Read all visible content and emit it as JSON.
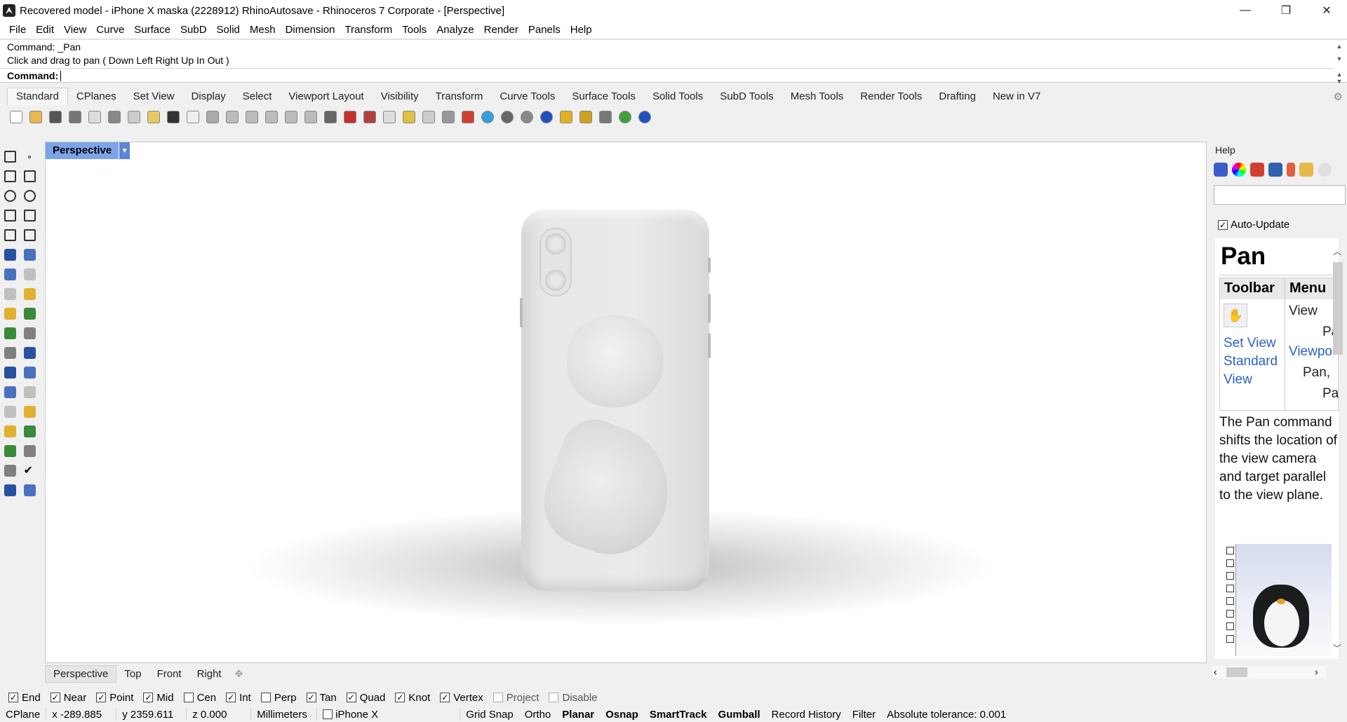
{
  "window": {
    "title": "Recovered model - iPhone X maska (2228912) RhinoAutosave - Rhinoceros 7 Corporate - [Perspective]",
    "minimize": "—",
    "restore": "❐",
    "close": "✕"
  },
  "menu": [
    "File",
    "Edit",
    "View",
    "Curve",
    "Surface",
    "SubD",
    "Solid",
    "Mesh",
    "Dimension",
    "Transform",
    "Tools",
    "Analyze",
    "Render",
    "Panels",
    "Help"
  ],
  "command": {
    "history_1": "Command: _Pan",
    "history_2": "Click and drag to pan ( Down  Left  Right  Up  In  Out )",
    "prompt": "Command:"
  },
  "toolbar_tabs": [
    "Standard",
    "CPlanes",
    "Set View",
    "Display",
    "Select",
    "Viewport Layout",
    "Visibility",
    "Transform",
    "Curve Tools",
    "Surface Tools",
    "Solid Tools",
    "SubD Tools",
    "Mesh Tools",
    "Render Tools",
    "Drafting",
    "New in V7"
  ],
  "toolbar_icons": [
    {
      "name": "new-file-icon",
      "color": "#ffffff"
    },
    {
      "name": "open-folder-icon",
      "color": "#e8b84a"
    },
    {
      "name": "save-icon",
      "color": "#555555"
    },
    {
      "name": "print-icon",
      "color": "#777777"
    },
    {
      "name": "export-icon",
      "color": "#dddddd"
    },
    {
      "name": "cut-icon",
      "color": "#888888"
    },
    {
      "name": "copy-icon",
      "color": "#cccccc"
    },
    {
      "name": "paste-icon",
      "color": "#e8c860"
    },
    {
      "name": "undo-icon",
      "color": "#333333"
    },
    {
      "name": "pan-hand-icon",
      "color": "#eeeeee"
    },
    {
      "name": "rotate-view-icon",
      "color": "#aaaaaa"
    },
    {
      "name": "zoom-icon",
      "color": "#bbbbbb"
    },
    {
      "name": "zoom-window-icon",
      "color": "#bbbbbb"
    },
    {
      "name": "zoom-extents-icon",
      "color": "#bbbbbb"
    },
    {
      "name": "zoom-selected-icon",
      "color": "#bbbbbb"
    },
    {
      "name": "undo-view-icon",
      "color": "#bbbbbb"
    },
    {
      "name": "four-viewports-icon",
      "color": "#666666"
    },
    {
      "name": "car-shaded-icon",
      "color": "#c83030"
    },
    {
      "name": "car-wire-icon",
      "color": "#b04040"
    },
    {
      "name": "gumball-icon",
      "color": "#dddddd"
    },
    {
      "name": "select-points-icon",
      "color": "#e0c040"
    },
    {
      "name": "light-bulb-icon",
      "color": "#cccccc"
    },
    {
      "name": "lock-icon",
      "color": "#999999"
    },
    {
      "name": "layers-icon",
      "color": "#d04030"
    },
    {
      "name": "color-wheel-icon",
      "color": "#30a0e0"
    },
    {
      "name": "sphere-shaded-icon",
      "color": "#666666"
    },
    {
      "name": "sphere-render-icon",
      "color": "#888888"
    },
    {
      "name": "sphere-blue-icon",
      "color": "#2050c0"
    },
    {
      "name": "spotlight-icon",
      "color": "#e0b020"
    },
    {
      "name": "settings-gear-icon",
      "color": "#d0a020"
    },
    {
      "name": "dimension-icon",
      "color": "#777777"
    },
    {
      "name": "globe-icon",
      "color": "#40a040"
    },
    {
      "name": "help-icon",
      "color": "#2050c0"
    }
  ],
  "left_tools": [
    [
      "select-arrow-icon",
      "point-icon"
    ],
    [
      "polyline-icon",
      "curve-control-points-icon"
    ],
    [
      "circle-icon",
      "ellipse-icon"
    ],
    [
      "polygon-icon",
      "rectangle-icon"
    ],
    [
      "fillet-curve-icon",
      "arc-icon"
    ],
    [
      "surface-from-points-icon",
      "extrude-curve-icon"
    ],
    [
      "box-icon",
      "boolean-union-icon"
    ],
    [
      "cylinder-icon",
      "plane-surface-icon"
    ],
    [
      "explode-icon",
      "trim-lightning-icon"
    ],
    [
      "split-icon",
      "join-icon"
    ],
    [
      "group-icon",
      "ungroup-icon"
    ],
    [
      "rotate-icon",
      "offset-icon"
    ],
    [
      "text-icon",
      "scale-icon"
    ],
    [
      "array-icon",
      "mirror-icon"
    ],
    [
      "mesh-box-icon",
      "dimension-line-icon"
    ],
    [
      "grid-array-icon",
      "block-icon"
    ],
    [
      "analyze-icon",
      "check-icon"
    ],
    [
      "render-object-icon",
      "section-icon"
    ]
  ],
  "viewport": {
    "label": "Perspective"
  },
  "view_tabs": [
    "Perspective",
    "Top",
    "Front",
    "Right"
  ],
  "view_tab_add": "✥",
  "panel": {
    "title": "Help",
    "auto_update_label": "Auto-Update",
    "auto_update_checked": true,
    "heading": "Pan",
    "col_toolbar": "Toolbar",
    "col_menu": "Menu",
    "link_set_view": "Set View",
    "link_standard": "Standard",
    "link_view": "View",
    "menu_view": "View",
    "menu_pa": "Pa",
    "menu_viewport": "Viewpo",
    "menu_pan": "Pan,",
    "menu_pa2": "Pa",
    "description": "The Pan command shifts the location of the view camera and target parallel to the view plane."
  },
  "osnaps": [
    {
      "label": "End",
      "checked": true
    },
    {
      "label": "Near",
      "checked": true
    },
    {
      "label": "Point",
      "checked": true
    },
    {
      "label": "Mid",
      "checked": true
    },
    {
      "label": "Cen",
      "checked": false
    },
    {
      "label": "Int",
      "checked": true
    },
    {
      "label": "Perp",
      "checked": false
    },
    {
      "label": "Tan",
      "checked": true
    },
    {
      "label": "Quad",
      "checked": true
    },
    {
      "label": "Knot",
      "checked": true
    },
    {
      "label": "Vertex",
      "checked": true
    },
    {
      "label": "Project",
      "checked": false,
      "disabled": true
    },
    {
      "label": "Disable",
      "checked": false,
      "disabled": true
    }
  ],
  "status": {
    "cplane": "CPlane",
    "x": "x -289.885",
    "y": "y 2359.611",
    "z": "z 0.000",
    "units": "Millimeters",
    "layer": "iPhone X",
    "grid_snap": "Grid Snap",
    "ortho": "Ortho",
    "planar": "Planar",
    "osnap": "Osnap",
    "smarttrack": "SmartTrack",
    "gumball": "Gumball",
    "record_history": "Record History",
    "filter": "Filter",
    "tolerance": "Absolute tolerance: 0.001"
  }
}
